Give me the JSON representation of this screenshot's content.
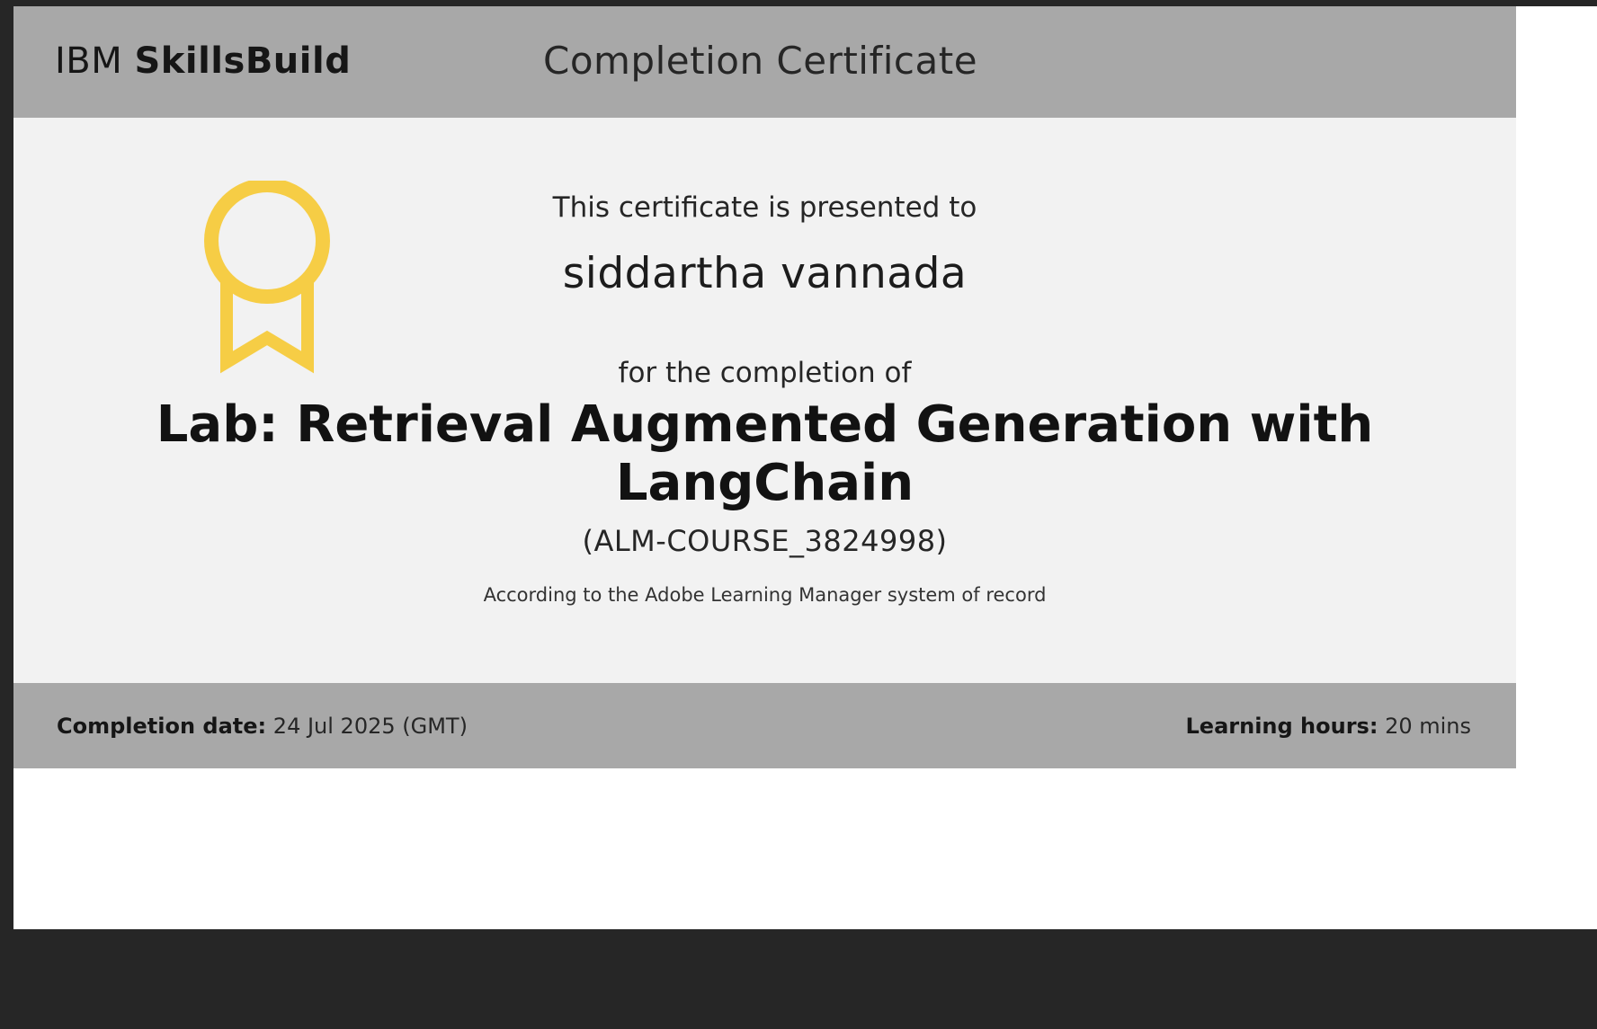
{
  "brand": {
    "prefix": "IBM",
    "name": "SkillsBuild"
  },
  "header": {
    "title": "Completion Certificate"
  },
  "certificate": {
    "presented_text": "This certificate is presented to",
    "recipient": "siddartha vannada",
    "completion_text": "for the completion of",
    "course_title_lines": [
      "Lab: Retrieval Augmented Generation with",
      "LangChain"
    ],
    "course_code": "(ALM-COURSE_3824998)",
    "record_note": "According to the Adobe Learning Manager system of record"
  },
  "footer": {
    "completion_label": "Completion date:",
    "completion_value": "24 Jul 2025 (GMT)",
    "hours_label": "Learning hours:",
    "hours_value": "20 mins"
  },
  "icons": {
    "badge": "award-ribbon-icon"
  },
  "colors": {
    "header_bg": "#a8a8a8",
    "body_bg": "#f2f2f2",
    "badge": "#f6cd45",
    "frame": "#262626"
  }
}
